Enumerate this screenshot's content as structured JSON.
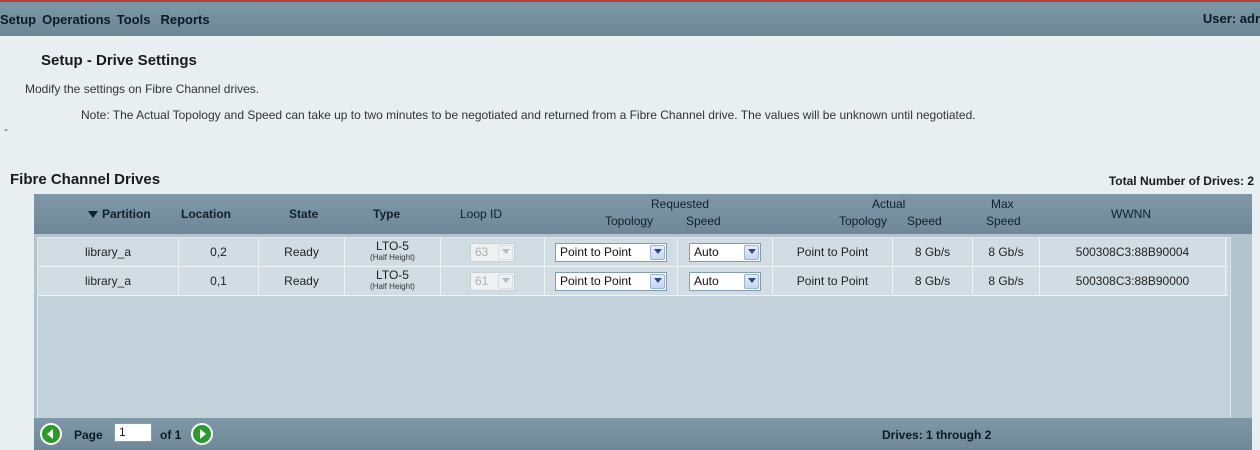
{
  "menubar": {
    "items": [
      "Setup",
      "Operations",
      "Tools",
      "Reports"
    ],
    "user": "User: adr"
  },
  "page": {
    "title": "Setup - Drive Settings",
    "description": "Modify the settings on Fibre Channel drives.",
    "note": "Note: The Actual Topology and Speed can take up to two minutes to be negotiated and returned from a Fibre Channel drive. The values will be unknown until negotiated.",
    "side_mark": "-"
  },
  "section": {
    "title": "Fibre Channel Drives",
    "total": "Total Number of Drives: 2"
  },
  "table": {
    "headers": {
      "partition": "Partition",
      "location": "Location",
      "state": "State",
      "type": "Type",
      "loop_id": "Loop ID",
      "requested": "Requested",
      "req_topology": "Topology",
      "req_speed": "Speed",
      "actual": "Actual",
      "act_topology": "Topology",
      "act_speed": "Speed",
      "max": "Max",
      "max_speed": "Speed",
      "wwnn": "WWNN"
    },
    "sort_icon": "sort-descending-icon",
    "rows": [
      {
        "partition": "library_a",
        "location": "0,2",
        "state": "Ready",
        "type": "LTO-5",
        "type_sub": "(Half Height)",
        "loop_id": "63",
        "req_topology": "Point to Point",
        "req_speed": "Auto",
        "act_topology": "Point to Point",
        "act_speed": "8 Gb/s",
        "max_speed": "8 Gb/s",
        "wwnn": "500308C3:88B90004"
      },
      {
        "partition": "library_a",
        "location": "0,1",
        "state": "Ready",
        "type": "LTO-5",
        "type_sub": "(Half Height)",
        "loop_id": "61",
        "req_topology": "Point to Point",
        "req_speed": "Auto",
        "act_topology": "Point to Point",
        "act_speed": "8 Gb/s",
        "max_speed": "8 Gb/s",
        "wwnn": "500308C3:88B90000"
      }
    ]
  },
  "footer": {
    "page_label": "Page",
    "page_value": "1",
    "of_label": "of 1",
    "drives_range": "Drives: 1 through 2"
  },
  "colors": {
    "menubar": "#6f8897",
    "nav_button": "#2a9a2a",
    "row_bg": "#d2dde3"
  }
}
